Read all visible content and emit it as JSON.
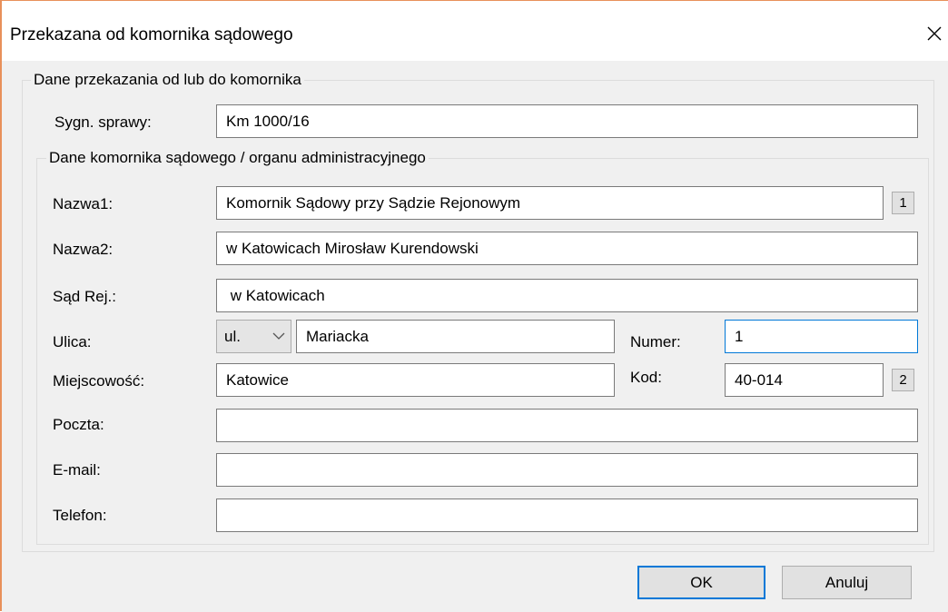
{
  "window": {
    "title": "Przekazana od komornika sądowego",
    "close_symbol": "✕"
  },
  "group_main": {
    "title": "Dane przekazania od lub do komornika",
    "case_label": "Sygn. sprawy:",
    "case_value": "Km 1000/16"
  },
  "group_bailiff": {
    "title": "Dane komornika sądowego / organu administracyjnego",
    "name1_label": "Nazwa1:",
    "name1_value": "Komornik Sądowy przy Sądzie Rejonowym",
    "name1_btn": "1",
    "name2_label": "Nazwa2:",
    "name2_value": "w Katowicach Mirosław Kurendowski",
    "court_label": "Sąd Rej.:",
    "court_value": " w Katowicach",
    "street_label": "Ulica:",
    "street_prefix": "ul.",
    "street_value": "Mariacka",
    "number_label": "Numer:",
    "number_value": "1",
    "city_label": "Miejscowość:",
    "city_value": "Katowice",
    "postcode_label": "Kod:",
    "postcode_value": "40-014",
    "postcode_btn": "2",
    "post_label": "Poczta:",
    "post_value": "",
    "email_label": "E-mail:",
    "email_value": "",
    "phone_label": "Telefon:",
    "phone_value": ""
  },
  "buttons": {
    "ok": "OK",
    "cancel": "Anuluj"
  },
  "colors": {
    "accent": "#0078d7",
    "window_border": "#e8905a",
    "dialog_bg": "#f0f0f0"
  }
}
